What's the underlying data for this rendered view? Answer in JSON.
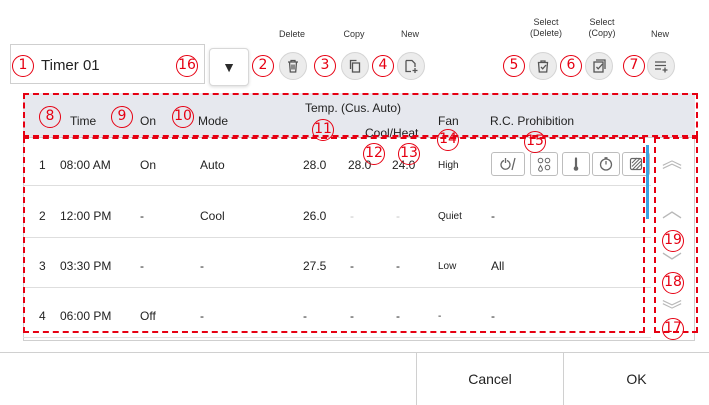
{
  "toolbar": {
    "delete_label": "Delete",
    "copy_label": "Copy",
    "new_label": "New",
    "select_delete_label": "Select\n(Delete)",
    "select_copy_label": "Select\n(Copy)",
    "new_row_label": "New"
  },
  "timer": {
    "name": "Timer 01",
    "dropdown_glyph": "▼"
  },
  "headers": {
    "time": "Time",
    "on": "On",
    "mode": "Mode",
    "temp_top": "Temp. (Cus. Auto)",
    "temp_sub": "Cool/Heat",
    "fan": "Fan",
    "rc_prohibition": "R.C. Prohibition"
  },
  "rows": [
    {
      "num": "1",
      "time": "08:00 AM",
      "on": "On",
      "mode": "Auto",
      "temp": "28.0",
      "cool": "28.0",
      "heat": "24.0",
      "fan": "High",
      "rc": ""
    },
    {
      "num": "2",
      "time": "12:00 PM",
      "on": "-",
      "mode": "Cool",
      "temp": "26.0",
      "cool": "-",
      "heat": "-",
      "fan": "Quiet",
      "rc": "-"
    },
    {
      "num": "3",
      "time": "03:30 PM",
      "on": "-",
      "mode": "-",
      "temp": "27.5",
      "cool": "-",
      "heat": "-",
      "fan": "Low",
      "rc": "All"
    },
    {
      "num": "4",
      "time": "06:00 PM",
      "on": "Off",
      "mode": "-",
      "temp": "-",
      "cool": "-",
      "heat": "-",
      "fan": "-",
      "rc": "-"
    }
  ],
  "prohibition_icons": [
    "power-onoff-icon",
    "mode-icon",
    "temperature-icon",
    "timer-icon",
    "filter-icon"
  ],
  "callouts": {
    "c1": "1",
    "c2": "2",
    "c3": "3",
    "c4": "4",
    "c5": "5",
    "c6": "6",
    "c7": "7",
    "c8": "8",
    "c9": "9",
    "c10": "10",
    "c11": "11",
    "c12": "12",
    "c13": "13",
    "c14": "14",
    "c15": "15",
    "c16": "16",
    "c17": "17",
    "c18": "18",
    "c19": "19"
  },
  "footer": {
    "cancel_label": "Cancel",
    "ok_label": "OK"
  },
  "colors": {
    "callout_red": "#e60012",
    "scroll_blue": "#3aa3e3",
    "header_bg": "#e6e8ee"
  }
}
